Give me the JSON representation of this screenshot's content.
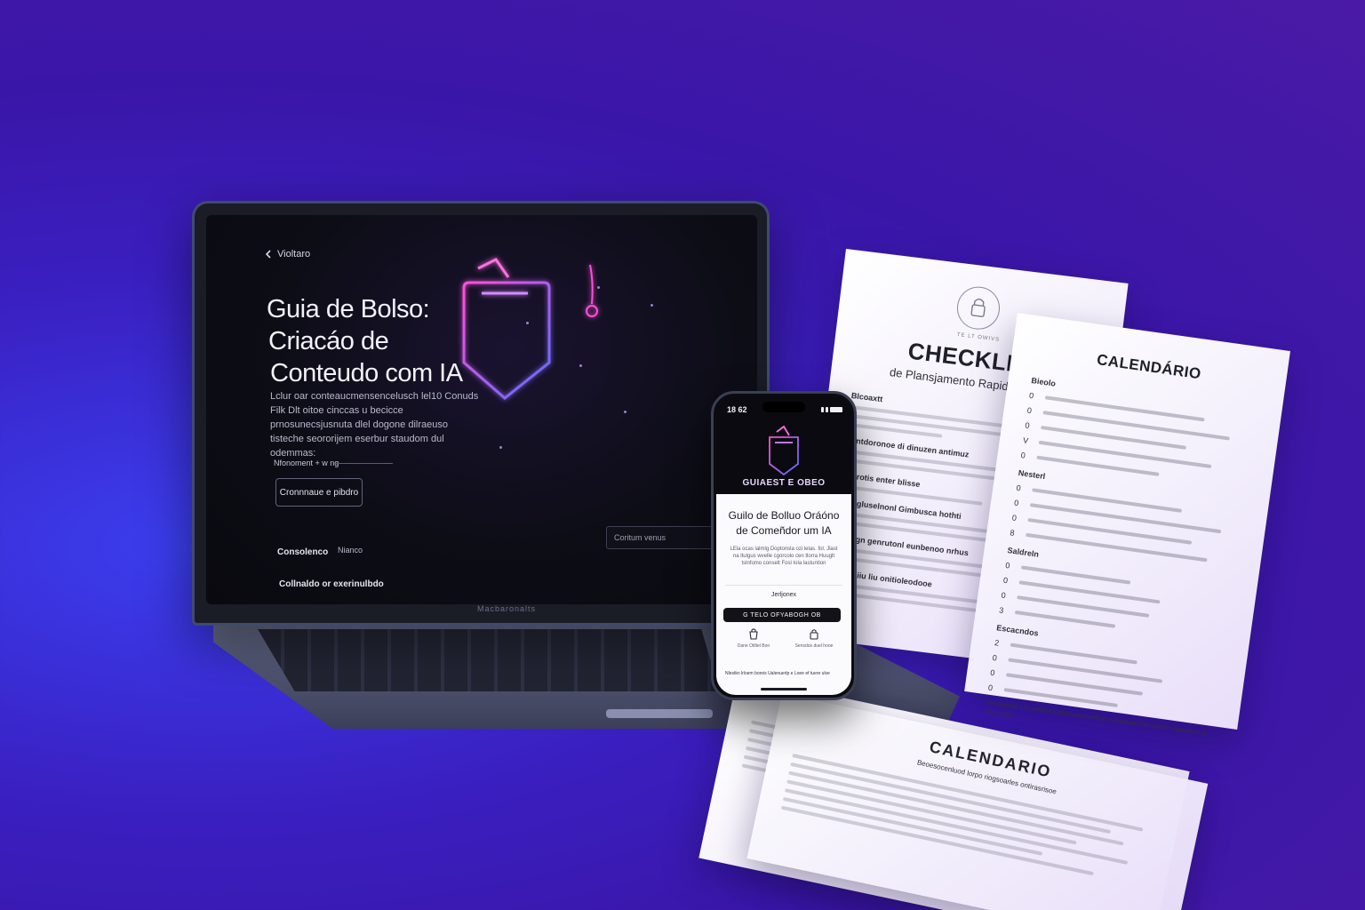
{
  "laptop": {
    "back_label": "Violtaro",
    "hero_title_lines": [
      "Guia de Bolso:",
      "Criacáo de",
      "Conteudo com IA"
    ],
    "hero_description": "Lclur oar conteaucmensencelusch lel10 Conuds Filk Dlt oitoe cinccas u becicce prnosunecsjusnuta dlel dogone dilraeuso tisteche seororijem eserbur staudom dul odemmas:",
    "meta_label": "Nfonoment + w ng",
    "cta_label": "Cronnnaue e pibdro",
    "nav_item_1": "Consolenco",
    "nav_item_2": "Nianco",
    "nav_item_3": "Collnaldo or exerinulbdo",
    "side_field_text": "Coritum venus",
    "brand_text": "Macbaronalts",
    "accent_pink": "#e040c8",
    "accent_blue": "#5a6cff"
  },
  "phone": {
    "time": "18 62",
    "brand": "GUIAEST E OBEO",
    "title": "Guilo de Bolluo Oráóno de Comeñdor um IA",
    "description": "LEla ocas lalmlg Doptonsla ozi lelas. fol. Jlast na ltulgus wvelle cgorcolo cen tlorra Huuglt tslnfomo conselt Fosl Iola lastuntion",
    "small_label": "Jerljonex",
    "button_label": "G TELO OFYABOGH OB",
    "icon_label_1": "Dane Otlltel Bon",
    "icon_label_2": "Sensdos duel hooe",
    "footer_text": "Nlestkn lrloem boreis Ualenuerlp e Loee ef tuere ulve"
  },
  "checklist": {
    "seal_text": "TE LT OWIVS",
    "title": "CHECKLIST",
    "subtitle": "de Plansjamento Rapidopara ke:",
    "sections": [
      "Blcoaxtt",
      "Bentdoronoe di dinuzen antimuz",
      "Denrotis enter blisse",
      "Weclgluselnonl Gimbusca hothti",
      "Eneulgn genrutonl eunbenoo nrhus",
      "Betfogliiu liu onitioleodooe"
    ]
  },
  "calendar": {
    "title": "CALENDÁRIO",
    "sections": [
      "Bieolo",
      "Nesterl",
      "Saldreln",
      "Escacndos"
    ],
    "row_numbers": [
      "0",
      "0",
      "0",
      "V",
      "0",
      "0",
      "0",
      "0",
      "8",
      "0",
      "0",
      "0",
      "3",
      "2",
      "0",
      "0",
      "0"
    ],
    "footer": "Nesaluuvat a Io dedtebrloutlerestesenlrdmin nuitanstarr Pra ajuljolo ulrasamon ni nostnopso"
  },
  "bottom_paper": {
    "title": "CALENDARIO",
    "header": "Beoesocenluod lorpo riogsoarles ontirasrisoe"
  }
}
